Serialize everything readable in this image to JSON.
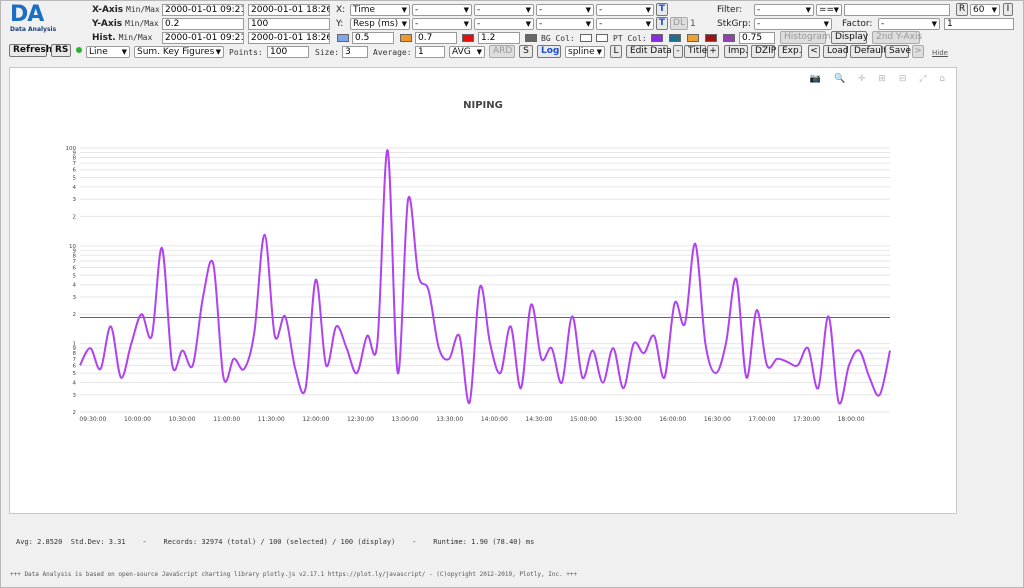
{
  "logo": {
    "abbr": "DA",
    "name": "Data Analysis"
  },
  "rows": {
    "x_axis": {
      "label": "X-Axis",
      "minmax": "Min/Max",
      "min": "2000-01-01 09:21:2",
      "max": "2000-01-01 18:26:1"
    },
    "y_axis": {
      "label": "Y-Axis",
      "minmax": "Min/Max",
      "min": "0.2",
      "max": "100"
    },
    "hist": {
      "label": "Hist.",
      "minmax": "Min/Max",
      "min": "2000-01-01 09:21:2",
      "max": "2000-01-01 18:26:1"
    }
  },
  "axes": {
    "x_label": "X:",
    "x_select": "Time",
    "x_opts": [
      "-",
      "-",
      "-",
      "-"
    ],
    "t_btn": "T",
    "y_label": "Y:",
    "y_select": "Resp (ms)",
    "y_opts": [
      "-",
      "-",
      "-",
      "-"
    ],
    "dl_btn": "DL",
    "dl_value": "1"
  },
  "thresholds": {
    "v1": "0.5",
    "v2": "0.7",
    "v3": "1.2",
    "bg_col": "BG Col:",
    "pt_col": "PT Col:",
    "pt_value": "0.75",
    "colors": {
      "blue": "#7fa6e8",
      "orange": "#f0962a",
      "red": "#e01010",
      "grey": "#666666",
      "pt1": "#8a2be2",
      "pt2": "#1e6e8c",
      "pt3": "#f0a030",
      "pt4": "#a01010",
      "pt5": "#8e44ad"
    }
  },
  "right_panel": {
    "filter_label": "Filter:",
    "filter_select": "-",
    "filter_op": "==",
    "filter_value": "",
    "r_btn": "R",
    "r_value": "60",
    "i_btn": "I",
    "stkgrp_label": "StkGrp:",
    "stkgrp_select": "-",
    "factor_label": "Factor:",
    "factor_select": "-",
    "factor_value": "1",
    "histogram_btn": "Histogram",
    "display_btn": "Display",
    "second_axis_btn": "2nd Y-Axis"
  },
  "controls": {
    "refresh": "Refresh",
    "rs": "RS",
    "chart_type": "Line",
    "agg": "Sum. Key Figures",
    "points_label": "Points:",
    "points": "100",
    "size_label": "Size:",
    "size": "3",
    "average_label": "Average:",
    "average": "1",
    "avg_mode": "AVG",
    "ard": "ARD",
    "s": "S",
    "log": "Log",
    "interp": "spline",
    "l": "L",
    "edit_data": "Edit Data",
    "minus": "-",
    "title": "Title",
    "plus": "+",
    "imp": "Imp.",
    "dzip": "DZIP",
    "exp": "Exp.",
    "prev": "<",
    "load": "Load",
    "default": "Default",
    "save": "Save",
    "next": ">",
    "hide": "Hide"
  },
  "chart_data": {
    "type": "line",
    "title": "NIPING",
    "y_scale": "log",
    "ylim": [
      2,
      100
    ],
    "y_tick_labels": [
      "2",
      "3",
      "4",
      "5",
      "6",
      "7",
      "8",
      "9",
      "1",
      "2",
      "3",
      "4",
      "5",
      "6",
      "7",
      "8",
      "9",
      "10",
      "2",
      "3",
      "4",
      "5",
      "6",
      "7",
      "8",
      "9",
      "100"
    ],
    "x_tick_labels": [
      "09:30:00",
      "10:00:00",
      "10:30:00",
      "11:00:00",
      "11:30:00",
      "12:00:00",
      "12:30:00",
      "13:00:00",
      "13:30:00",
      "14:00:00",
      "14:30:00",
      "15:00:00",
      "15:30:00",
      "16:00:00",
      "16:30:00",
      "17:00:00",
      "17:30:00",
      "18:00:00"
    ],
    "x_start": "09:21:20",
    "x_end": "18:26:10",
    "series_color": "#b042f0",
    "reference_line": 1.85,
    "values": [
      0.6,
      0.9,
      0.55,
      1.5,
      0.45,
      1.0,
      2.0,
      1.2,
      9.5,
      0.6,
      0.85,
      0.6,
      3.0,
      6.5,
      0.45,
      0.7,
      0.55,
      1.3,
      13.0,
      1.2,
      1.9,
      0.55,
      0.35,
      4.5,
      0.6,
      1.5,
      0.9,
      0.5,
      1.2,
      1.0,
      95.0,
      0.5,
      30.0,
      5.0,
      3.5,
      0.9,
      0.7,
      1.2,
      0.25,
      3.8,
      1.0,
      0.5,
      1.5,
      0.35,
      2.5,
      0.7,
      0.9,
      0.4,
      1.9,
      0.45,
      0.85,
      0.4,
      0.9,
      0.35,
      1.0,
      0.8,
      1.2,
      0.45,
      2.6,
      1.6,
      10.5,
      1.0,
      0.5,
      1.0,
      4.6,
      0.45,
      2.2,
      0.6,
      0.7,
      0.65,
      0.6,
      0.9,
      0.35,
      1.9,
      0.25,
      0.6,
      0.85,
      0.45,
      0.3,
      0.85
    ]
  },
  "status": {
    "text": "Avg: 2.8520  Std.Dev: 3.31    -    Records: 32974 (total) / 100 (selected) / 100 (display)    -    Runtime: 1.90 (78.40) ms"
  },
  "footer": {
    "text": "+++ Data Analysis is based on open-source JavaScript charting library plotly.js v2.17.1 https://plot.ly/javascript/ - (C)opyright 2012-2019, Plotly, Inc. +++"
  },
  "modebar": {
    "icons": "📷 🔍 ✛ ⊞ ⊟ ⤢ ⌂"
  }
}
